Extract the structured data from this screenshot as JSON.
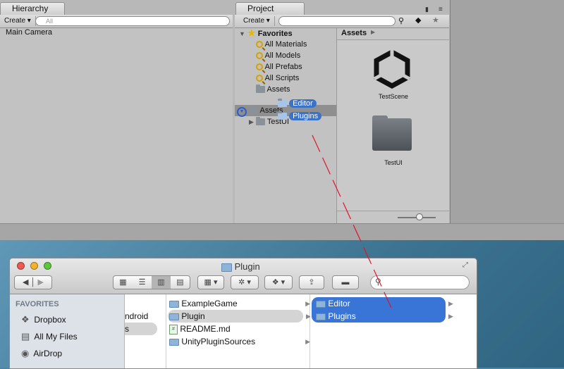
{
  "hierarchy": {
    "tab_label": "Hierarchy",
    "create_label": "Create ▾",
    "search_placeholder": "All",
    "items": [
      "Main Camera"
    ]
  },
  "project": {
    "tab_label": "Project",
    "create_label": "Create ▾",
    "favorites_label": "Favorites",
    "favorites": [
      "All Materials",
      "All Models",
      "All Prefabs",
      "All Scripts",
      "Assets"
    ],
    "assets_label": "Assets",
    "testui_label": "TestUI",
    "breadcrumb": "Assets",
    "grid_items": [
      "TestScene",
      "TestUI"
    ]
  },
  "drag": {
    "items": [
      "Editor",
      "Plugins"
    ]
  },
  "finder": {
    "title": "Plugin",
    "sidebar_heading": "FAVORITES",
    "sidebar_items": [
      "Dropbox",
      "All My Files",
      "AirDrop"
    ],
    "col1_items": [
      "ndroid",
      "s"
    ],
    "col2_items": [
      "ExampleGame",
      "Plugin",
      "README.md",
      "UnityPluginSources"
    ],
    "col3_items": [
      "Editor",
      "Plugins"
    ]
  },
  "colors": {
    "selection": "#3875d7",
    "drag_line": "#e0142a"
  }
}
